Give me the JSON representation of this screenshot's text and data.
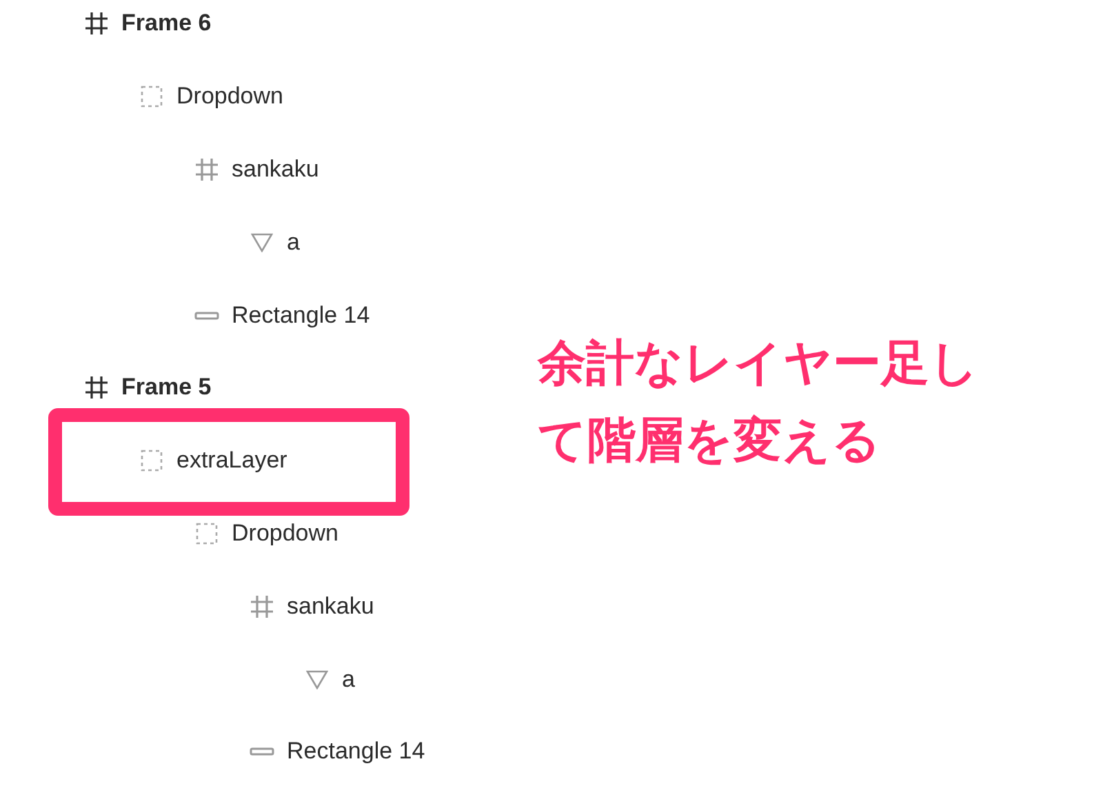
{
  "layers": [
    {
      "name": "Frame 6",
      "kind": "frame",
      "highlighted": false,
      "children": [
        {
          "name": "Dropdown",
          "kind": "dashed",
          "highlighted": false,
          "children": [
            {
              "name": "sankaku",
              "kind": "frame",
              "highlighted": false,
              "children": [
                {
                  "name": "a",
                  "kind": "triangle",
                  "highlighted": false
                }
              ]
            },
            {
              "name": "Rectangle 14",
              "kind": "rectangle",
              "highlighted": false
            }
          ]
        }
      ]
    },
    {
      "name": "Frame 5",
      "kind": "frame",
      "highlighted": false,
      "children": [
        {
          "name": "extraLayer",
          "kind": "dashed",
          "highlighted": true,
          "children": [
            {
              "name": "Dropdown",
              "kind": "dashed",
              "highlighted": false,
              "children": [
                {
                  "name": "sankaku",
                  "kind": "frame",
                  "highlighted": false,
                  "children": [
                    {
                      "name": "a",
                      "kind": "triangle",
                      "highlighted": false
                    }
                  ]
                },
                {
                  "name": "Rectangle 14",
                  "kind": "rectangle",
                  "highlighted": false
                }
              ]
            }
          ]
        }
      ]
    }
  ],
  "annotation": {
    "text": "余計なレイヤー足して階層を変える"
  }
}
